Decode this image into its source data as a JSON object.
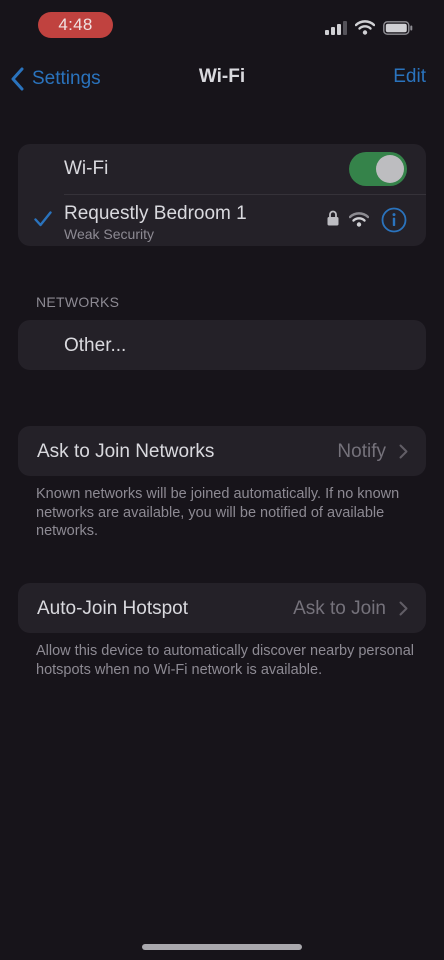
{
  "status_bar": {
    "time": "4:48"
  },
  "nav": {
    "back_label": "Settings",
    "title": "Wi-Fi",
    "edit_label": "Edit"
  },
  "wifi": {
    "toggle_label": "Wi-Fi",
    "enabled": true,
    "connected_network": {
      "name": "Requestly Bedroom 1",
      "subtitle": "Weak Security"
    }
  },
  "networks": {
    "header": "NETWORKS",
    "other_label": "Other..."
  },
  "ask_to_join": {
    "label": "Ask to Join Networks",
    "value": "Notify",
    "footnote": "Known networks will be joined automatically. If no known networks are available, you will be notified of available networks."
  },
  "auto_join_hotspot": {
    "label": "Auto-Join Hotspot",
    "value": "Ask to Join",
    "footnote": "Allow this device to automatically discover nearby personal hotspots when no Wi-Fi network is available."
  },
  "colors": {
    "accent": "#2a73bd",
    "toggle_on": "#35834a",
    "time_pill": "#c0423f"
  },
  "icons": {
    "cellular": "cellular-signal-icon",
    "wifi_status": "wifi-icon",
    "battery": "battery-icon",
    "back": "chevron-left-icon",
    "checkmark": "checkmark-icon",
    "lock": "lock-icon",
    "wifi_signal": "wifi-signal-icon",
    "info": "info-icon",
    "disclosure": "chevron-right-icon"
  }
}
